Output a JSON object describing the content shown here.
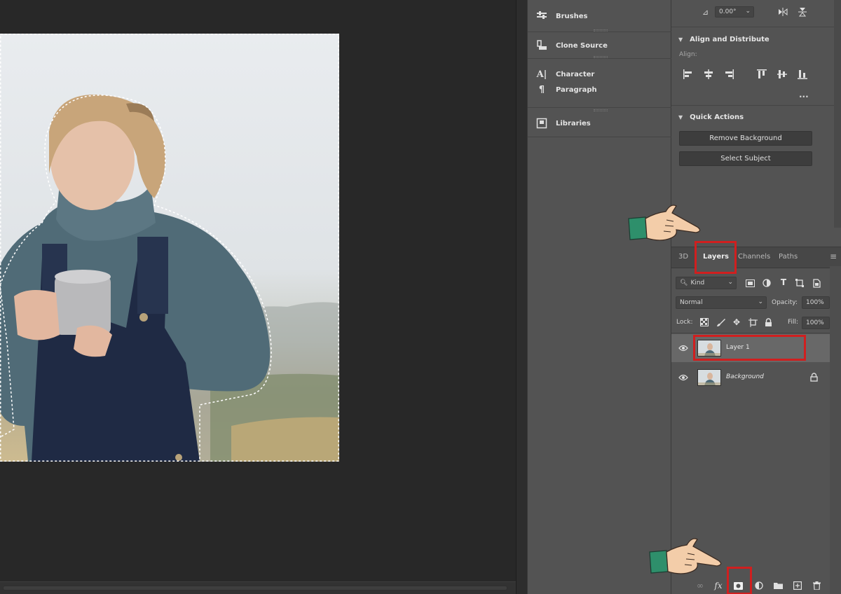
{
  "left_dock": {
    "items": [
      {
        "label": "Brushes",
        "icon": "brushes-icon"
      },
      {
        "label": "Clone Source",
        "icon": "clone-source-icon"
      },
      {
        "label": "Character",
        "icon": "character-icon"
      },
      {
        "label": "Paragraph",
        "icon": "paragraph-icon"
      },
      {
        "label": "Libraries",
        "icon": "libraries-icon"
      }
    ]
  },
  "properties": {
    "angle_value": "0.00°",
    "align_distribute": {
      "title": "Align and Distribute",
      "subtitle": "Align:",
      "more": "..."
    },
    "quick_actions": {
      "title": "Quick Actions",
      "remove_background": "Remove Background",
      "select_subject": "Select Subject"
    }
  },
  "layers_panel": {
    "tabs": [
      {
        "label": "3D",
        "active": false
      },
      {
        "label": "Layers",
        "active": true
      },
      {
        "label": "Channels",
        "active": false
      },
      {
        "label": "Paths",
        "active": false
      }
    ],
    "filter": {
      "kind": "Kind"
    },
    "blend_mode": "Normal",
    "opacity_label": "Opacity:",
    "opacity_value": "100%",
    "lock_label": "Lock:",
    "fill_label": "Fill:",
    "fill_value": "100%",
    "layers": [
      {
        "name": "Layer 1",
        "selected": true,
        "visible": true,
        "locked": false
      },
      {
        "name": "Background",
        "selected": false,
        "visible": true,
        "locked": true
      }
    ],
    "footer_icons": [
      "link-layers-icon",
      "fx-icon",
      "add-mask-icon",
      "adjustment-layer-icon",
      "new-group-icon",
      "new-layer-icon",
      "delete-layer-icon"
    ],
    "fx_label": "fx"
  },
  "colors": {
    "highlight": "#d01f1f",
    "panel": "#535353",
    "canvas_bg": "#282828"
  }
}
